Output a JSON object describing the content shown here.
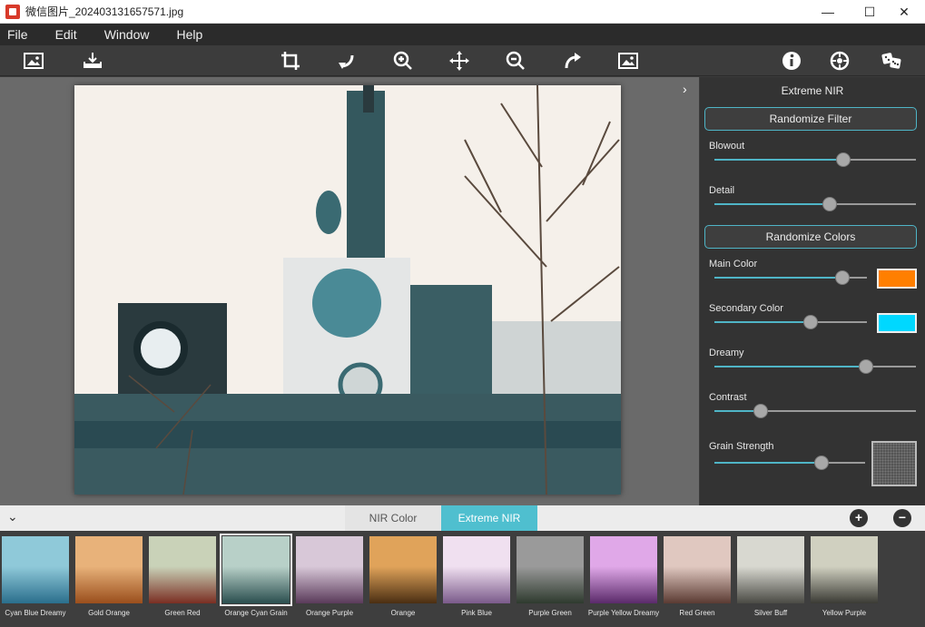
{
  "window": {
    "title": "微信图片_202403131657571.jpg",
    "minimize": "—",
    "maximize": "☐",
    "close": "✕"
  },
  "menu": [
    "File",
    "Edit",
    "Window",
    "Help"
  ],
  "toolbar": {
    "icons": [
      "open-image-icon",
      "save-icon",
      "crop-icon",
      "rotate-left-icon",
      "zoom-in-icon",
      "pan-icon",
      "zoom-out-icon",
      "rotate-right-icon",
      "compare-icon",
      "info-icon",
      "settings-icon",
      "randomize-dice-icon"
    ]
  },
  "canvas": {
    "collapse_right": "›"
  },
  "panel": {
    "title": "Extreme NIR",
    "randomize_filter": "Randomize Filter",
    "randomize_colors": "Randomize Colors",
    "blowout": {
      "label": "Blowout",
      "value": 0.64
    },
    "detail": {
      "label": "Detail",
      "value": 0.57
    },
    "main_color": {
      "label": "Main Color",
      "value": 0.84,
      "color": "#ff7f00"
    },
    "secondary_color": {
      "label": "Secondary Color",
      "value": 0.63,
      "color": "#00d8ff"
    },
    "dreamy": {
      "label": "Dreamy",
      "value": 0.75
    },
    "contrast": {
      "label": "Contrast",
      "value": 0.23
    },
    "grain": {
      "label": "Grain Strength",
      "value": 0.71
    }
  },
  "tabs": {
    "collapse_down": "⌄",
    "nir_color": "NIR Color",
    "extreme_nir": "Extreme NIR",
    "add": "+",
    "remove": "−"
  },
  "presets": [
    {
      "name": "Cyan Blue Dreamy",
      "colors": [
        "#8fc9d9",
        "#2a6e8c"
      ]
    },
    {
      "name": "Gold Orange",
      "colors": [
        "#e8b27a",
        "#9a4e1c"
      ]
    },
    {
      "name": "Green Red",
      "colors": [
        "#c9d2b8",
        "#7a2e22"
      ]
    },
    {
      "name": "Orange Cyan Grain",
      "colors": [
        "#b8d0c8",
        "#2a4e4e"
      ],
      "selected": true
    },
    {
      "name": "Orange Purple",
      "colors": [
        "#d8c8d8",
        "#5a3a5a"
      ]
    },
    {
      "name": "Orange",
      "colors": [
        "#e0a35a",
        "#4a2e12"
      ]
    },
    {
      "name": "Pink Blue",
      "colors": [
        "#f0e0f0",
        "#7a5a8a"
      ]
    },
    {
      "name": "Purple Green",
      "colors": [
        "#9a9a9a",
        "#2e3a2e"
      ]
    },
    {
      "name": "Purple Yellow Dreamy",
      "colors": [
        "#e0a8e8",
        "#5a2a6a"
      ]
    },
    {
      "name": "Red Green",
      "colors": [
        "#e0c8c0",
        "#5a3a32"
      ]
    },
    {
      "name": "Silver Buff",
      "colors": [
        "#d8d8d0",
        "#4a4a44"
      ]
    },
    {
      "name": "Yellow Purple",
      "colors": [
        "#d0d0c0",
        "#3a3a34"
      ]
    }
  ]
}
